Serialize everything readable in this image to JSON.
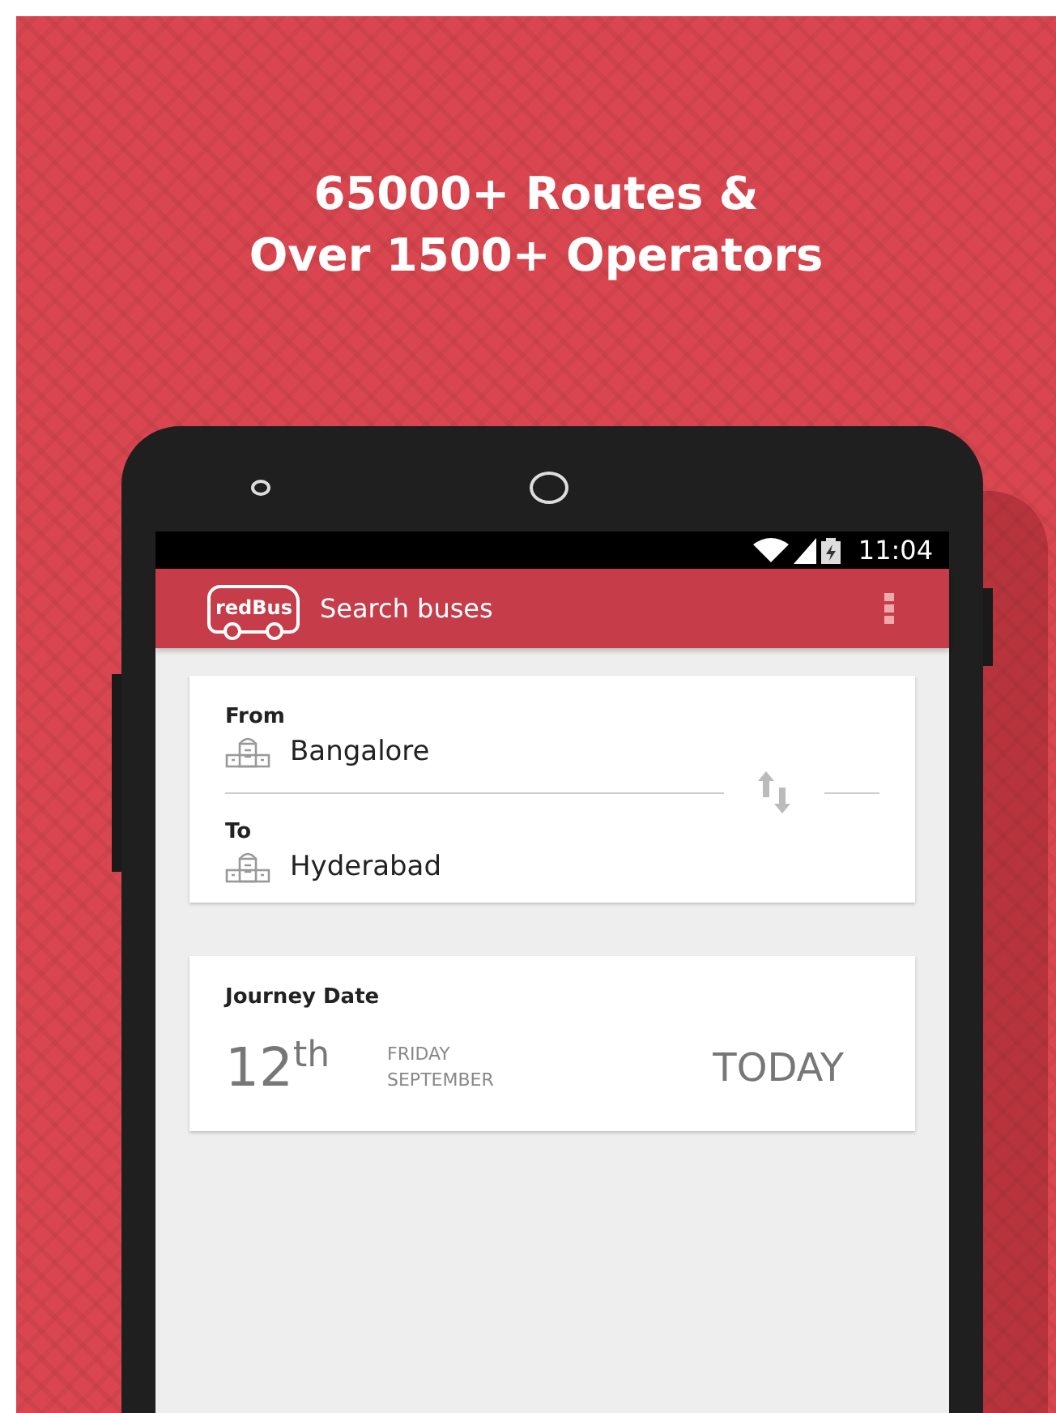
{
  "headline": [
    "65000+ Routes &",
    "Over 1500+ Operators"
  ],
  "status_bar": {
    "time": "11:04"
  },
  "app_bar": {
    "logo": "redBus",
    "title": "Search buses"
  },
  "route": {
    "from": {
      "label": "From",
      "city": "Bangalore"
    },
    "to": {
      "label": "To",
      "city": "Hyderabad"
    }
  },
  "journey_date": {
    "label": "Journey Date",
    "day": "12$^{th}$",
    "weekday": "FRIDAY",
    "month": "SEPTEMBER",
    "shortcut": "TODAY"
  }
}
